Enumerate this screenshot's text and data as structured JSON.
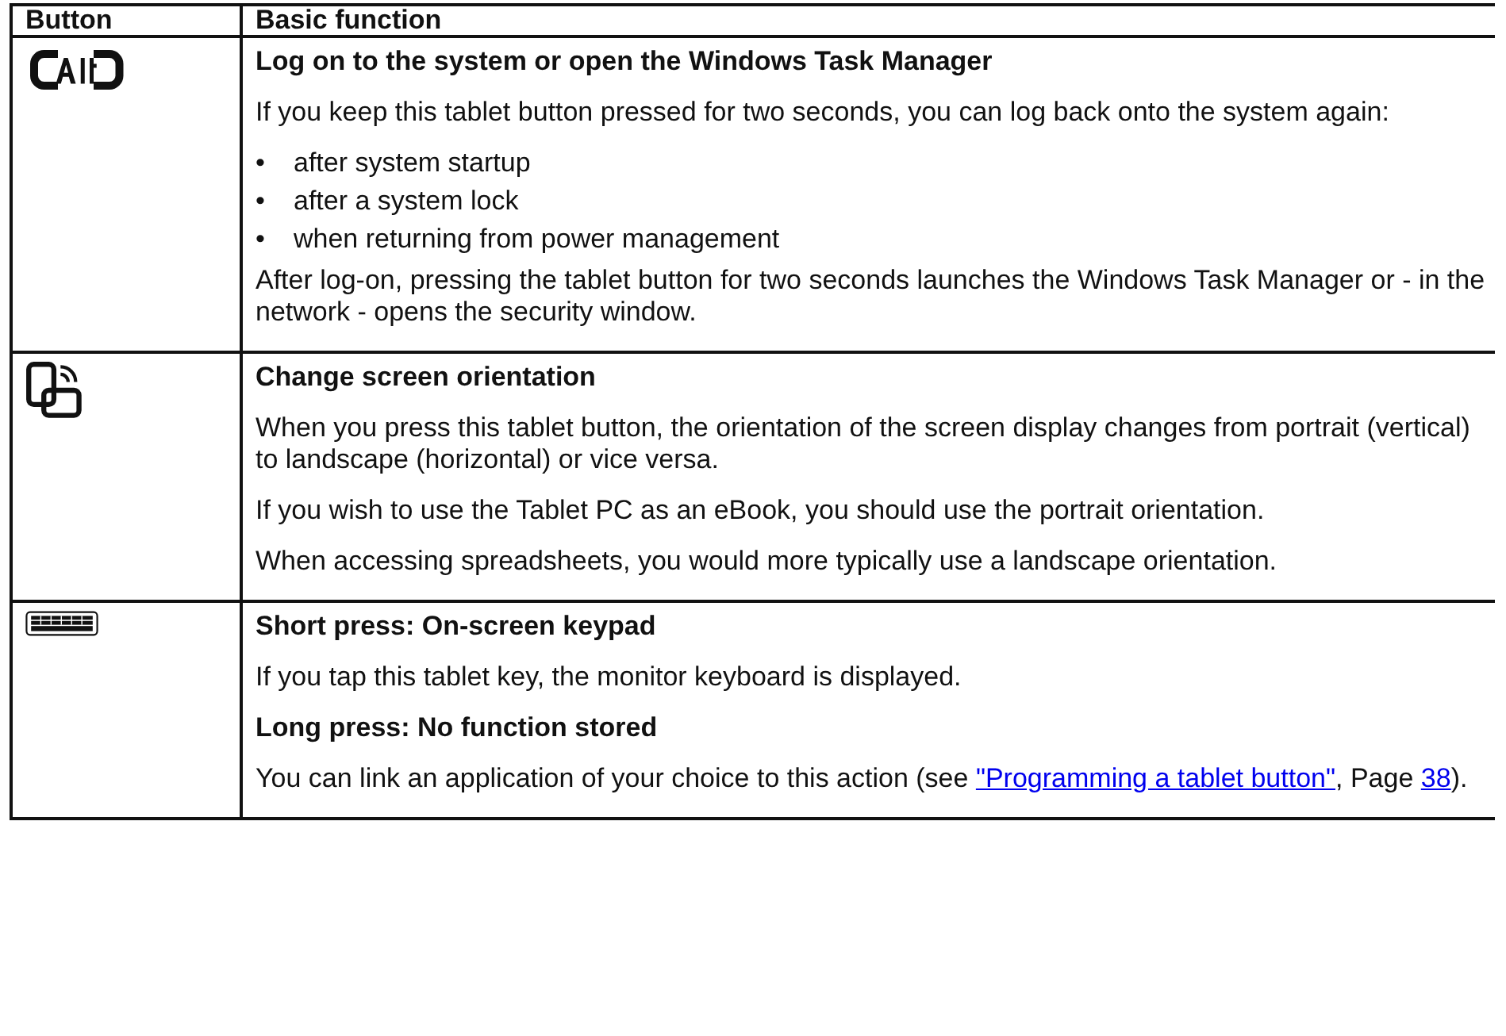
{
  "table": {
    "columns": [
      "Button",
      "Basic function"
    ],
    "rows": [
      {
        "kind": "alt",
        "blocks": [
          {
            "kind": "heading",
            "text": "Log on to the system or open the Windows Task Manager"
          },
          {
            "kind": "para",
            "text": "If you keep this tablet button pressed for two seconds, you can log back onto the system again:"
          },
          {
            "kind": "bullets",
            "bullet": "•",
            "items": [
              "after system startup",
              "after a system lock",
              "when returning from power management"
            ]
          },
          {
            "kind": "para",
            "text": "After log-on, pressing the tablet button for two seconds launches the Windows Task Manager or - in the network - opens the security window."
          }
        ]
      },
      {
        "kind": "rotate",
        "blocks": [
          {
            "kind": "heading",
            "text": "Change screen orientation"
          },
          {
            "kind": "para",
            "text": "When you press this tablet button, the orientation of the screen display changes from portrait (vertical) to landscape (horizontal) or vice versa."
          },
          {
            "kind": "para",
            "text": "If you wish to use the Tablet PC as an eBook, you should use the portrait orientation."
          },
          {
            "kind": "para",
            "text": "When accessing spreadsheets, you would more typically use a landscape orientation."
          }
        ]
      },
      {
        "kind": "keyboard",
        "blocks": [
          {
            "kind": "heading",
            "text": "Short press: On-screen keypad"
          },
          {
            "kind": "para",
            "text": "If you tap this tablet key, the monitor keyboard is displayed."
          },
          {
            "kind": "heading",
            "text": "Long press: No function stored"
          },
          {
            "kind": "linkpara",
            "parts": [
              {
                "text": "You can link an application of your choice to this action (see "
              },
              {
                "link": "\"Programming a tablet button\""
              },
              {
                "text": ", Page "
              },
              {
                "link": "38"
              },
              {
                "text": ")."
              }
            ]
          }
        ]
      }
    ]
  }
}
